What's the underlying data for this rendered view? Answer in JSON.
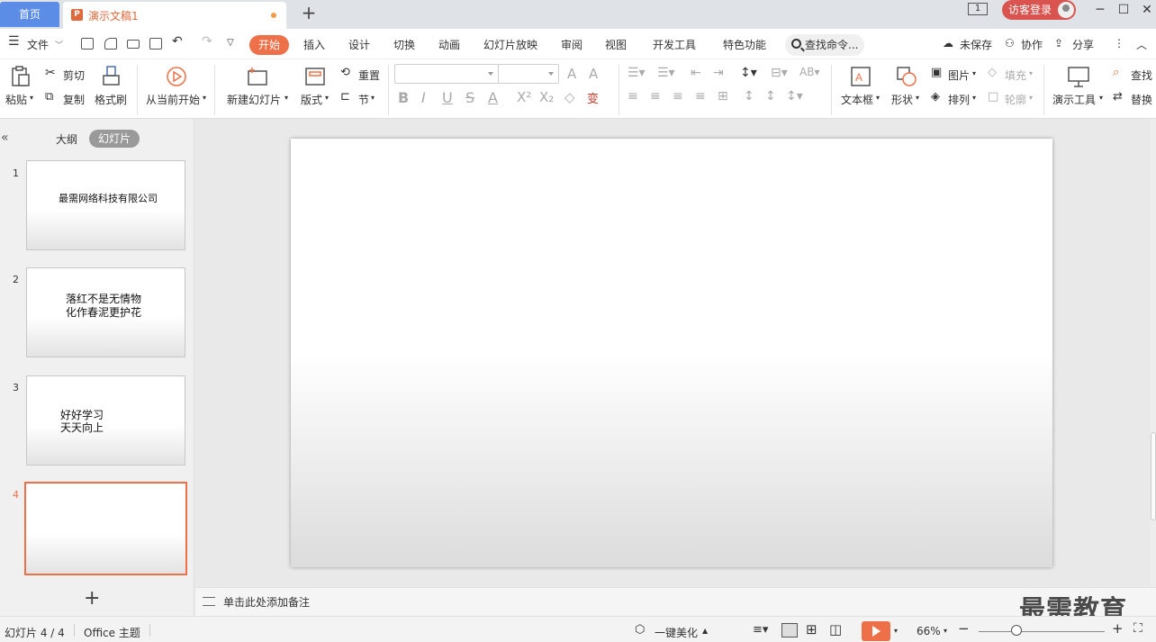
{
  "titlebar": {
    "home_tab": "首页",
    "doc_tab": "演示文稿1",
    "add_tab": "+",
    "window_badge": "1",
    "login": "访客登录"
  },
  "menu": {
    "file": "文件",
    "items": [
      "开始",
      "插入",
      "设计",
      "切换",
      "动画",
      "幻灯片放映",
      "审阅",
      "视图",
      "开发工具",
      "特色功能"
    ],
    "search": "查找命令...",
    "unsaved": "未保存",
    "collab": "协作",
    "share": "分享"
  },
  "ribbon": {
    "paste": "粘贴",
    "cut": "剪切",
    "copy": "复制",
    "format_painter": "格式刷",
    "from_current": "从当前开始",
    "new_slide": "新建幻灯片",
    "layout": "版式",
    "reset": "重置",
    "section": "节",
    "textbox": "文本框",
    "shape": "形状",
    "picture": "图片",
    "fill": "填充",
    "arrange": "排列",
    "outline": "轮廓",
    "present_tools": "演示工具",
    "find": "查找",
    "replace": "替换"
  },
  "panel": {
    "outline_tab": "大纲",
    "slides_tab": "幻灯片",
    "slides": [
      {
        "num": "1",
        "lines": [
          "最需网络科技有限公司"
        ]
      },
      {
        "num": "2",
        "lines": [
          "落红不是无情物",
          "化作春泥更护花"
        ]
      },
      {
        "num": "3",
        "lines": [
          "好好学习",
          "天天向上"
        ]
      },
      {
        "num": "4",
        "lines": []
      }
    ]
  },
  "notes": {
    "placeholder": "单击此处添加备注"
  },
  "watermark": "最需教育",
  "status": {
    "slide_count": "幻灯片 4 / 4",
    "theme": "Office 主题",
    "beautify": "一键美化",
    "zoom": "66%"
  },
  "colors": {
    "accent": "#ee7049",
    "home_tab": "#5b8de6",
    "login": "#d9534f"
  }
}
